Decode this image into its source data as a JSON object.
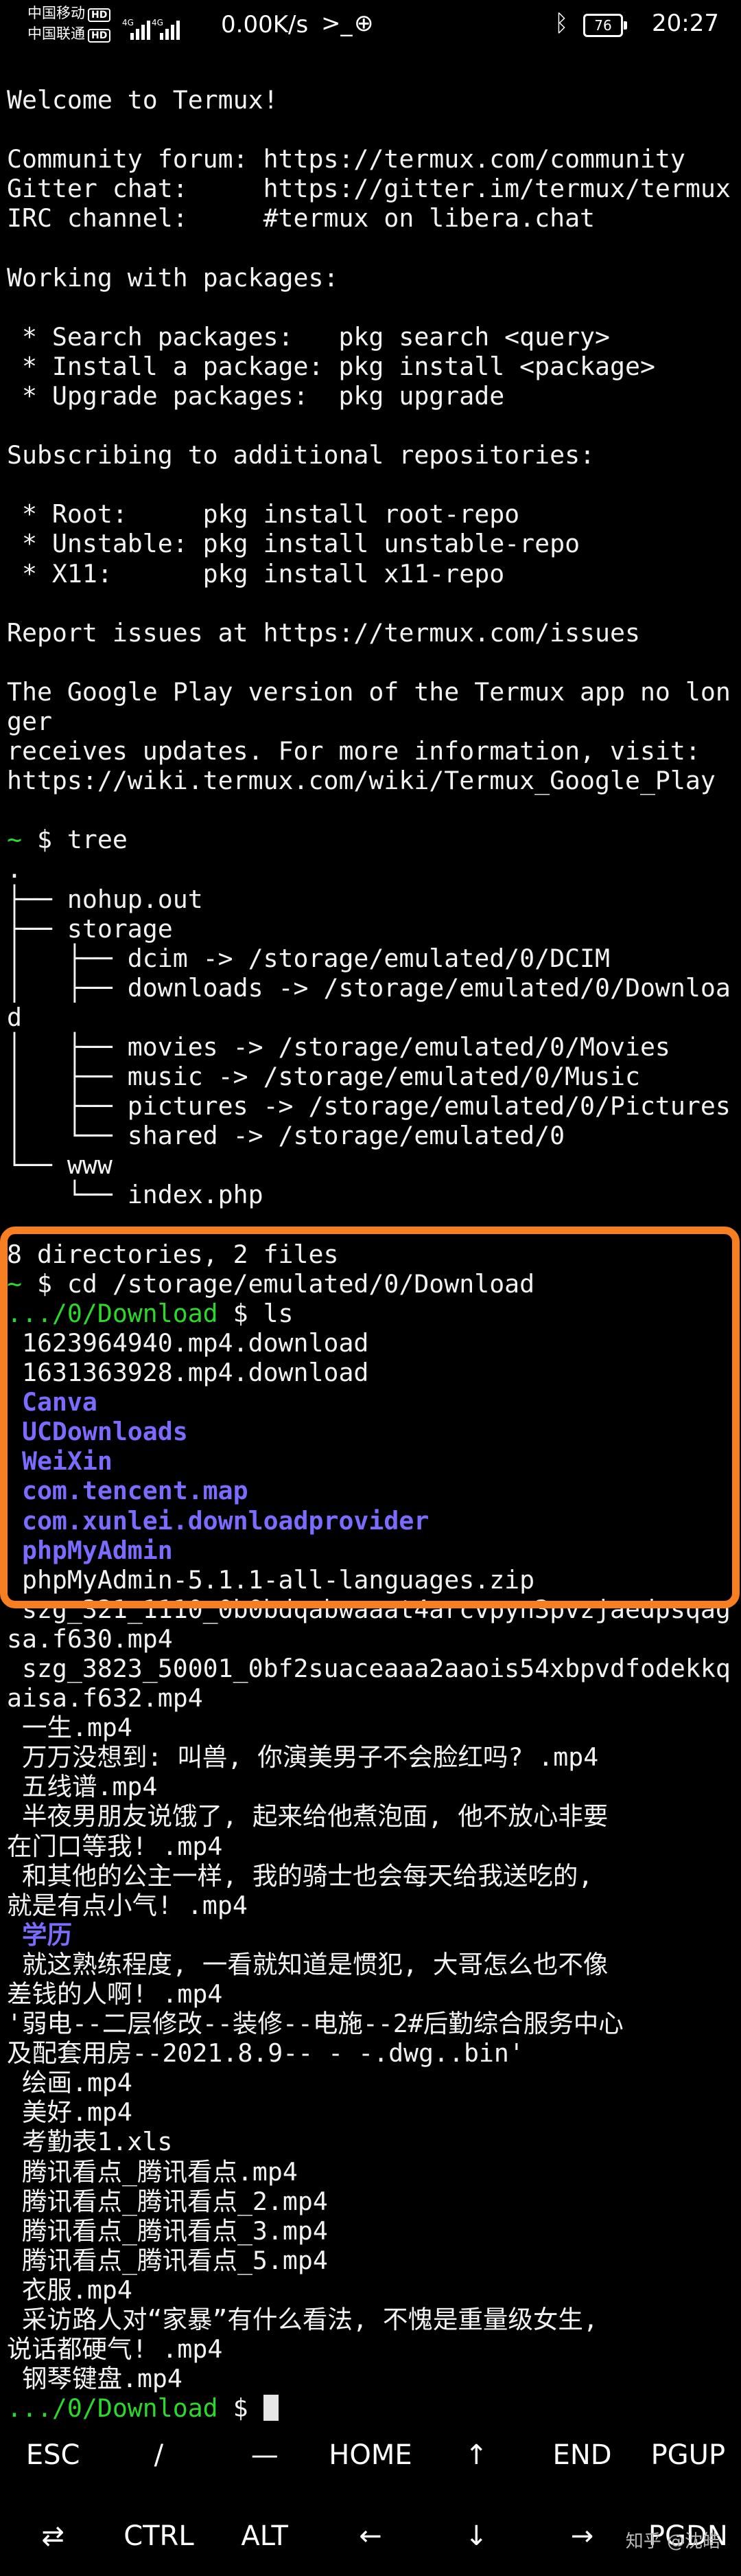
{
  "status_bar": {
    "carrier1": "中国移动",
    "carrier2": "中国联通",
    "hd_label": "HD",
    "net_label": "4G",
    "speed": "0.00K/s",
    "battery": "76",
    "time": "20:27"
  },
  "terminal": {
    "lines": [
      {
        "text": "Welcome to Termux!"
      },
      {
        "text": ""
      },
      {
        "text": "Community forum: https://termux.com/community"
      },
      {
        "text": "Gitter chat:     https://gitter.im/termux/termux"
      },
      {
        "text": "IRC channel:     #termux on libera.chat"
      },
      {
        "text": ""
      },
      {
        "text": "Working with packages:"
      },
      {
        "text": ""
      },
      {
        "text": " * Search packages:   pkg search <query>"
      },
      {
        "text": " * Install a package: pkg install <package>"
      },
      {
        "text": " * Upgrade packages:  pkg upgrade"
      },
      {
        "text": ""
      },
      {
        "text": "Subscribing to additional repositories:"
      },
      {
        "text": ""
      },
      {
        "text": " * Root:     pkg install root-repo"
      },
      {
        "text": " * Unstable: pkg install unstable-repo"
      },
      {
        "text": " * X11:      pkg install x11-repo"
      },
      {
        "text": ""
      },
      {
        "text": "Report issues at https://termux.com/issues"
      },
      {
        "text": ""
      },
      {
        "text": "The Google Play version of the Termux app no lon"
      },
      {
        "text": "ger"
      },
      {
        "text": "receives updates. For more information, visit:"
      },
      {
        "text": "https://wiki.termux.com/wiki/Termux_Google_Play"
      },
      {
        "text": ""
      },
      {
        "prompt": "~",
        "text": " $ tree"
      },
      {
        "text": "."
      },
      {
        "text": "├── nohup.out"
      },
      {
        "text": "├── storage"
      },
      {
        "text": "│   ├── dcim -> /storage/emulated/0/DCIM"
      },
      {
        "text": "│   ├── downloads -> /storage/emulated/0/Downloa"
      },
      {
        "text": "d"
      },
      {
        "text": "│   ├── movies -> /storage/emulated/0/Movies"
      },
      {
        "text": "│   ├── music -> /storage/emulated/0/Music"
      },
      {
        "text": "│   ├── pictures -> /storage/emulated/0/Pictures"
      },
      {
        "text": "│   └── shared -> /storage/emulated/0"
      },
      {
        "text": "└── www"
      },
      {
        "text": "    └── index.php"
      },
      {
        "text": ""
      },
      {
        "text": "8 directories, 2 files"
      },
      {
        "prompt": "~",
        "text": " $ cd /storage/emulated/0/Download"
      },
      {
        "prompt": ".../0/Download",
        "text": " $ ls"
      },
      {
        "text": " 1623964940.mp4.download"
      },
      {
        "text": " 1631363928.mp4.download"
      },
      {
        "text": " Canva",
        "cls": "blue"
      },
      {
        "text": " UCDownloads",
        "cls": "blue"
      },
      {
        "text": " WeiXin",
        "cls": "blue"
      },
      {
        "text": " com.tencent.map",
        "cls": "blue"
      },
      {
        "text": " com.xunlei.downloadprovider",
        "cls": "blue"
      },
      {
        "text": " phpMyAdmin",
        "cls": "blue"
      },
      {
        "text": " phpMyAdmin-5.1.1-all-languages.zip"
      },
      {
        "text": " szg_321_1110_0b0bdqabwaaat4arcvpyn3pvzjaedpsqag"
      },
      {
        "text": "sa.f630.mp4"
      },
      {
        "text": " szg_3823_50001_0bf2suaceaaa2aaois54xbpvdfodekkq"
      },
      {
        "text": "aisa.f632.mp4"
      },
      {
        "text": " 一生.mp4"
      },
      {
        "text": " 万万没想到: 叫兽, 你演美男子不会脸红吗? .mp4"
      },
      {
        "text": " 五线谱.mp4"
      },
      {
        "text": " 半夜男朋友说饿了, 起来给他煮泡面, 他不放心非要"
      },
      {
        "text": "在门口等我! .mp4"
      },
      {
        "text": " 和其他的公主一样, 我的骑士也会每天给我送吃的,"
      },
      {
        "text": "就是有点小气! .mp4"
      },
      {
        "text": " 学历",
        "cls": "blue"
      },
      {
        "text": " 就这熟练程度, 一看就知道是惯犯, 大哥怎么也不像"
      },
      {
        "text": "差钱的人啊! .mp4"
      },
      {
        "text": "'弱电--二层修改--装修--电施--2#后勤综合服务中心"
      },
      {
        "text": "及配套用房--2021.8.9-- - -.dwg..bin'"
      },
      {
        "text": " 绘画.mp4"
      },
      {
        "text": " 美好.mp4"
      },
      {
        "text": " 考勤表1.xls"
      },
      {
        "text": " 腾讯看点_腾讯看点.mp4"
      },
      {
        "text": " 腾讯看点_腾讯看点_2.mp4"
      },
      {
        "text": " 腾讯看点_腾讯看点_3.mp4"
      },
      {
        "text": " 腾讯看点_腾讯看点_5.mp4"
      },
      {
        "text": " 衣服.mp4"
      },
      {
        "text": " 采访路人对“家暴”有什么看法, 不愧是重量级女生,"
      },
      {
        "text": "说话都硬气! .mp4"
      },
      {
        "text": " 钢琴键盘.mp4"
      },
      {
        "prompt": ".../0/Download",
        "text": " $ ",
        "cursor": true
      }
    ]
  },
  "extra_keys": {
    "row1": [
      "ESC",
      "/",
      "—",
      "HOME",
      "↑",
      "END",
      "PGUP"
    ],
    "row2": [
      "⇄",
      "CTRL",
      "ALT",
      "←",
      "↓",
      "→",
      "PGDN"
    ]
  },
  "watermark": "知乎 @沈皓",
  "colors": {
    "prompt": "#2bd92b",
    "directory": "#7b6bff",
    "highlight_border": "#f77f22"
  }
}
